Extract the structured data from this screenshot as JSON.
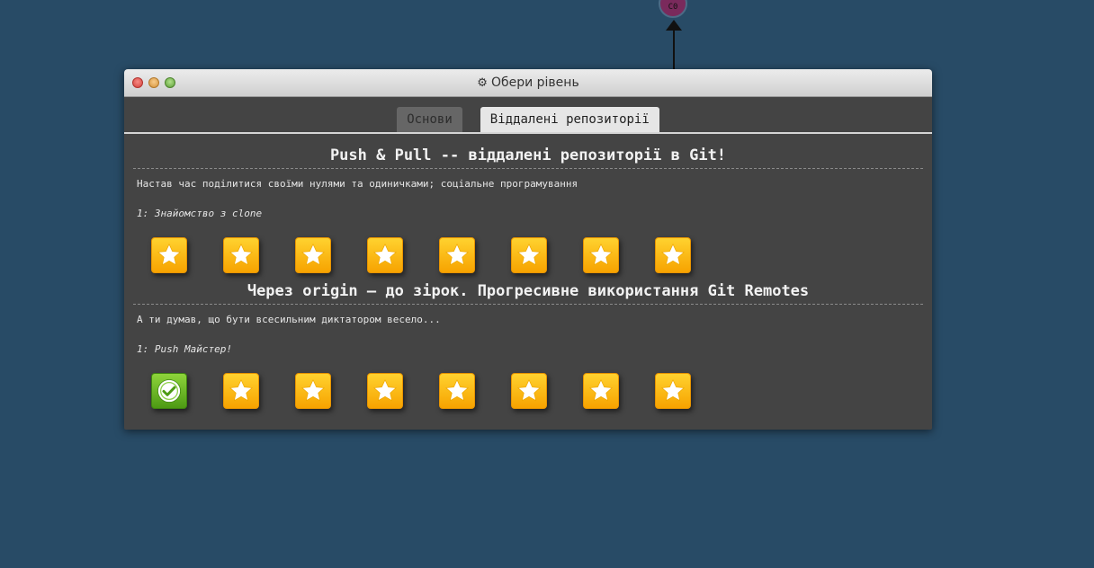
{
  "graph": {
    "node_label": "C0"
  },
  "window": {
    "title": "Обери рівень",
    "title_icon": "gear-icon"
  },
  "tabs": [
    {
      "label": "Основи",
      "active": false
    },
    {
      "label": "Віддалені репозиторії",
      "active": true
    }
  ],
  "sequences": [
    {
      "title": "Push & Pull -- віддалені репозиторії в Git!",
      "about": "Настав час поділитися своїми нулями та одиничками; соціальне програмування",
      "selected_level": "1: Знайомство з clone",
      "levels": [
        "star",
        "star",
        "star",
        "star",
        "star",
        "star",
        "star",
        "star"
      ]
    },
    {
      "title": "Через origin – до зірок. Прогресивне використання Git Remotes",
      "about": "А ти думав, що бути всесильним диктатором весело...",
      "selected_level": "1: Push Майстер!",
      "levels": [
        "done",
        "star",
        "star",
        "star",
        "star",
        "star",
        "star",
        "star"
      ]
    }
  ],
  "colors": {
    "background": "#284b66",
    "panel": "#444444",
    "star_badge": "#ffc21a",
    "done_badge": "#6ab82a"
  }
}
